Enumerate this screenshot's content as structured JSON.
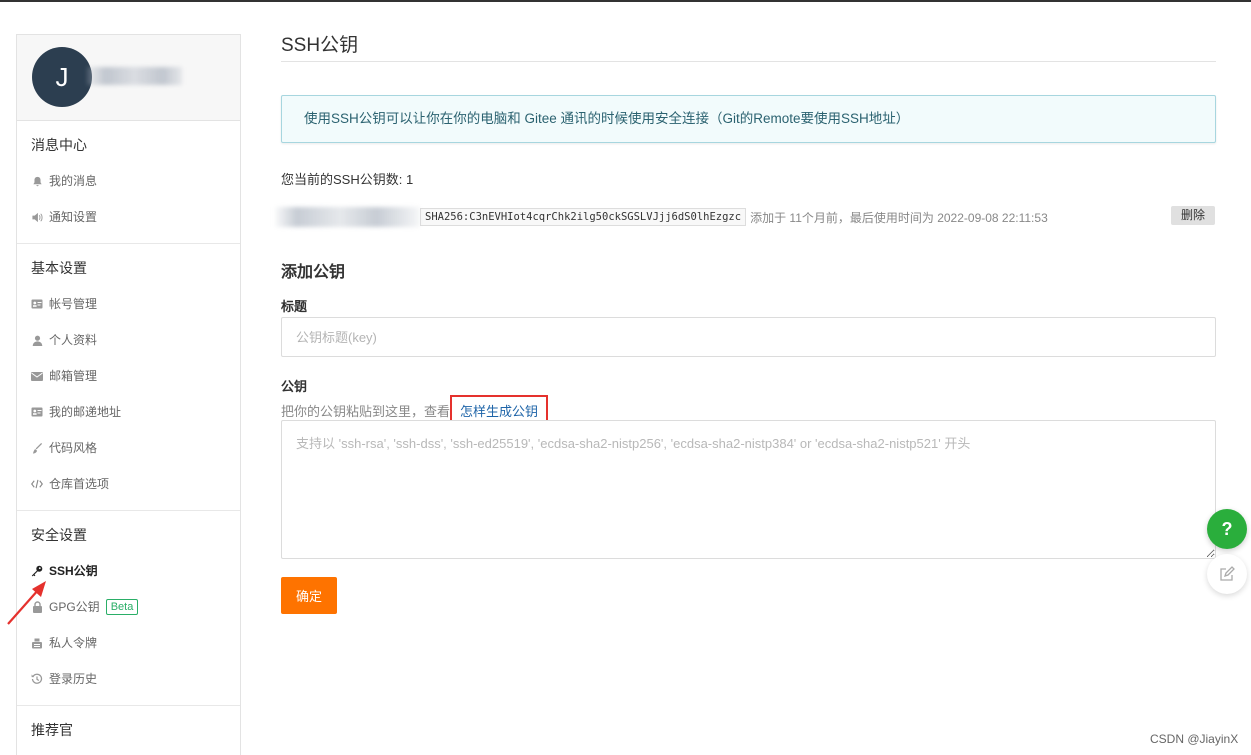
{
  "profile": {
    "initial": "J"
  },
  "sidebar": {
    "sections": [
      {
        "title": "消息中心",
        "items": [
          {
            "label": "我的消息",
            "icon": "bell-icon"
          },
          {
            "label": "通知设置",
            "icon": "volume-icon"
          }
        ]
      },
      {
        "title": "基本设置",
        "items": [
          {
            "label": "帐号管理",
            "icon": "id-card-icon"
          },
          {
            "label": "个人资料",
            "icon": "user-icon"
          },
          {
            "label": "邮箱管理",
            "icon": "mail-icon"
          },
          {
            "label": "我的邮递地址",
            "icon": "address-card-icon"
          },
          {
            "label": "代码风格",
            "icon": "brush-icon"
          },
          {
            "label": "仓库首选项",
            "icon": "code-icon"
          }
        ]
      },
      {
        "title": "安全设置",
        "items": [
          {
            "label": "SSH公钥",
            "icon": "key-icon",
            "active": true
          },
          {
            "label": "GPG公钥",
            "icon": "lock-icon",
            "badge": "Beta"
          },
          {
            "label": "私人令牌",
            "icon": "token-icon"
          },
          {
            "label": "登录历史",
            "icon": "history-icon"
          }
        ]
      },
      {
        "title": "推荐官",
        "items": []
      }
    ]
  },
  "main": {
    "page_title": "SSH公钥",
    "info": "使用SSH公钥可以让你在你的电脑和 Gitee 通讯的时候使用安全连接（Git的Remote要使用SSH地址）",
    "key_count": "您当前的SSH公钥数: 1",
    "key": {
      "fingerprint": "SHA256:C3nEVHIot4cqrChk2ilg50ckSGSLVJjj6dS0lhEzgzc",
      "meta": "添加于 11个月前，最后使用时间为 2022-09-08 22:11:53",
      "delete_label": "删除"
    },
    "add_title": "添加公钥",
    "title_label": "标题",
    "title_placeholder": "公钥标题(key)",
    "key_label": "公钥",
    "help_text": "把你的公钥粘贴到这里，查看",
    "help_link": "怎样生成公钥",
    "key_placeholder": "支持以 'ssh-rsa', 'ssh-dss', 'ssh-ed25519', 'ecdsa-sha2-nistp256', 'ecdsa-sha2-nistp384' or 'ecdsa-sha2-nistp521' 开头",
    "submit_label": "确定"
  },
  "floating": {
    "help": "?"
  },
  "watermark": "CSDN @JiayinX",
  "colors": {
    "accent": "#fe7300",
    "link": "#1e64a8",
    "highlight": "#e5312d",
    "help_green": "#2aae3c"
  }
}
